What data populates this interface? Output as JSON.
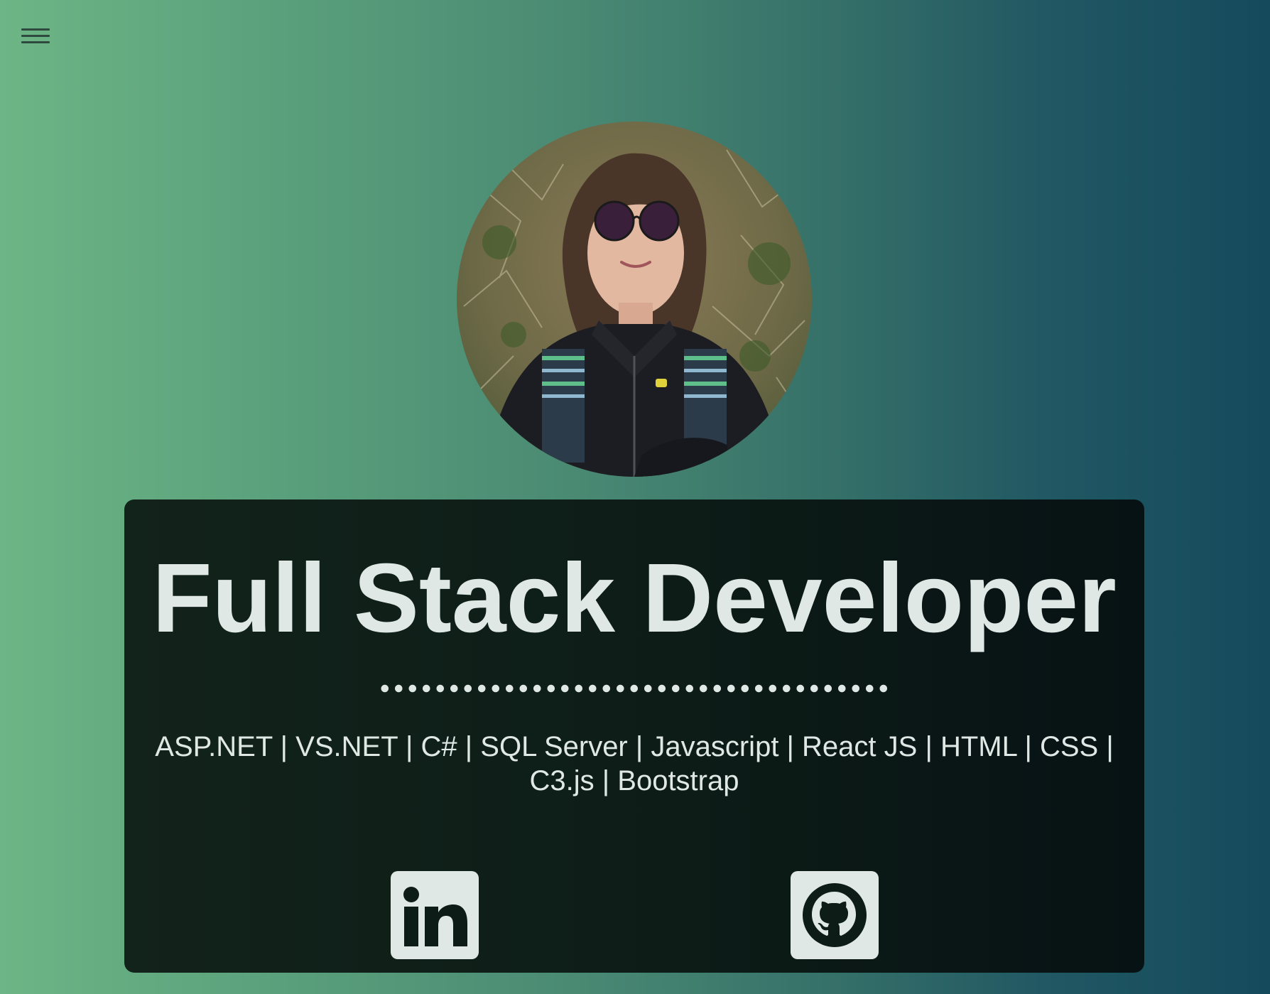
{
  "nav": {
    "menu_icon": "hamburger-menu-icon"
  },
  "profile": {
    "photo_alt": "Profile photo of a woman wearing round sunglasses and a dark zip jacket with striped backpack straps, outdoors in front of dry bushes",
    "title": "Full Stack Developer",
    "skills_line_1": "ASP.NET | VS.NET | C# | SQL Server | Javascript | React JS | HTML | CSS |",
    "skills_line_2": "C3.js | Bootstrap"
  },
  "social": [
    {
      "name": "LinkedIn",
      "icon": "linkedin-icon"
    },
    {
      "name": "GitHub",
      "icon": "github-icon"
    }
  ],
  "colors": {
    "gradient_left": "#6db585",
    "gradient_right": "#144a5c",
    "card_background": "#0d1c17",
    "text": "#dfe8e5",
    "menu_icon": "#2e4a3e"
  }
}
